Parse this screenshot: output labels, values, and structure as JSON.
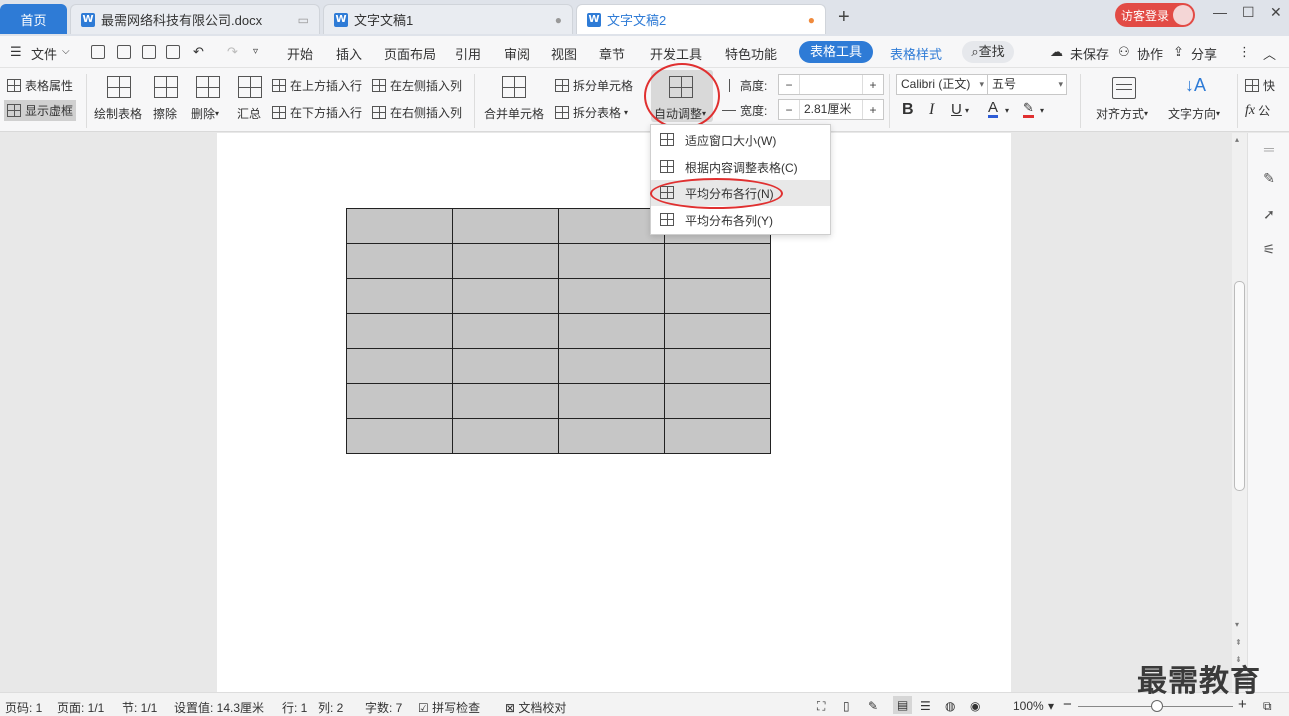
{
  "tabs": {
    "home": "首页",
    "doc1": "最需网络科技有限公司.docx",
    "doc2": "文字文稿1",
    "doc3": "文字文稿2",
    "new_tab": "+",
    "login": "访客登录"
  },
  "menu": {
    "file": "文件",
    "items": [
      "开始",
      "插入",
      "页面布局",
      "引用",
      "审阅",
      "视图",
      "章节",
      "开发工具",
      "特色功能"
    ],
    "table_tools": "表格工具",
    "table_style": "表格样式",
    "search": "查找",
    "unsaved": "未保存",
    "collab": "协作",
    "share": "分享"
  },
  "ribbon": {
    "table_props": "表格属性",
    "show_gridlines": "显示虚框",
    "draw_table": "绘制表格",
    "erase": "擦除",
    "delete": "删除",
    "summary": "汇总",
    "insert_above": "在上方插入行",
    "insert_below": "在下方插入行",
    "insert_left": "在左侧插入列",
    "insert_right": "在右侧插入列",
    "merge_cells": "合并单元格",
    "split_cells": "拆分单元格",
    "split_table": "拆分表格",
    "autofit": "自动调整",
    "height_label": "高度:",
    "height_value": "",
    "width_label": "宽度:",
    "width_value": "2.81厘米",
    "font_name": "Calibri (正文)",
    "font_size": "五号",
    "align": "对齐方式",
    "text_dir": "文字方向",
    "quick_calc": "快",
    "formula": "公"
  },
  "dropdown": {
    "items": [
      "适应窗口大小(W)",
      "根据内容调整表格(C)",
      "平均分布各行(N)",
      "平均分布各列(Y)"
    ],
    "selected_index": 2
  },
  "table": {
    "rows": 7,
    "cols": 4
  },
  "status": {
    "page_code": "页码: 1",
    "pages": "页面: 1/1",
    "section": "节: 1/1",
    "setting": "设置值: 14.3厘米",
    "row": "行: 1",
    "col": "列: 2",
    "words": "字数: 7",
    "spell": "拼写检查",
    "proof": "文档校对",
    "zoom": "100%",
    "zoom_level": 100
  },
  "watermark": "最需教育",
  "colors": {
    "accent": "#2e7bd6",
    "login": "#e24b45",
    "annotation": "#e03030"
  }
}
